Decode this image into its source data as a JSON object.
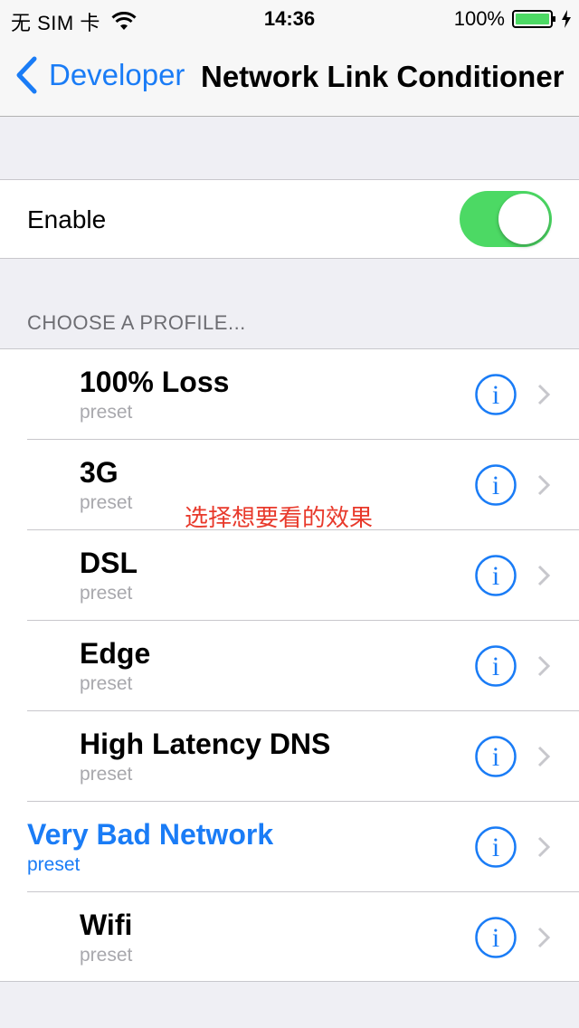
{
  "status_bar": {
    "carrier": "无 SIM 卡",
    "time": "14:36",
    "battery": "100%"
  },
  "nav": {
    "back_label": "Developer",
    "title": "Network Link Conditioner"
  },
  "enable": {
    "label": "Enable",
    "on": true
  },
  "section_header": "CHOOSE A PROFILE...",
  "profiles": [
    {
      "name": "100% Loss",
      "sub": "preset"
    },
    {
      "name": "3G",
      "sub": "preset"
    },
    {
      "name": "DSL",
      "sub": "preset"
    },
    {
      "name": "Edge",
      "sub": "preset"
    },
    {
      "name": "High Latency DNS",
      "sub": "preset"
    },
    {
      "name": "Very Bad Network",
      "sub": "preset"
    },
    {
      "name": "Wifi",
      "sub": "preset"
    }
  ],
  "annotation": "选择想要看的效果",
  "colors": {
    "accent": "#1a7cf6",
    "toggle_on": "#4cd964",
    "annotation": "#e8392b",
    "battery": "#4cd964"
  }
}
